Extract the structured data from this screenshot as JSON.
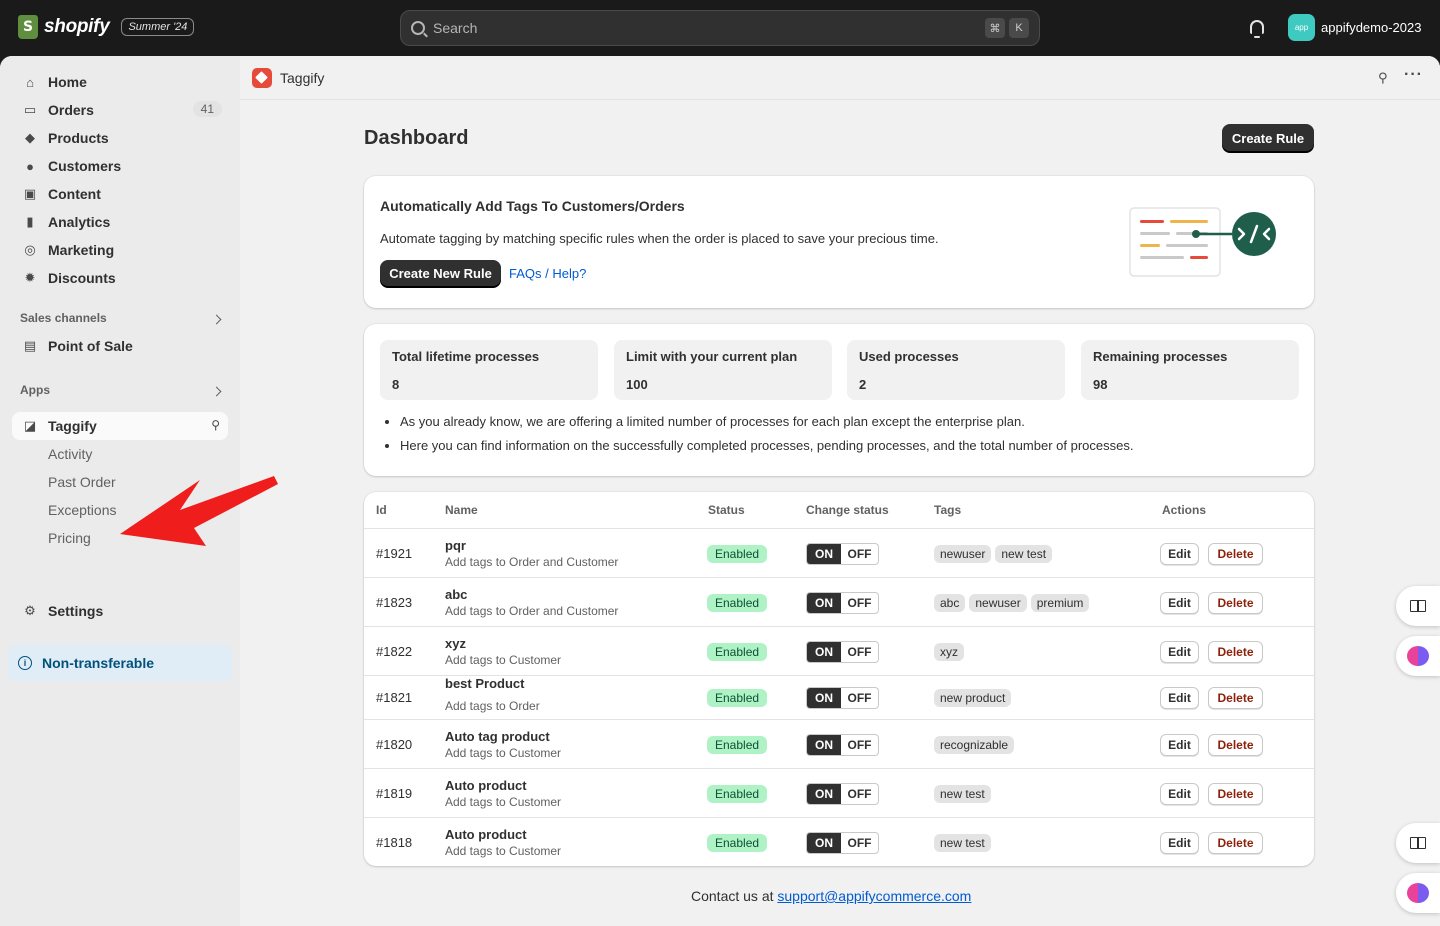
{
  "topbar": {
    "brand": "shopify",
    "edition": "Summer '24",
    "search_placeholder": "Search",
    "shortcut_keys": [
      "⌘",
      "K"
    ],
    "store_avatar": "app",
    "store_name": "appifydemo-2023"
  },
  "sidebar": {
    "items": [
      {
        "label": "Home",
        "icon": "home-icon"
      },
      {
        "label": "Orders",
        "icon": "orders-icon",
        "badge": "41"
      },
      {
        "label": "Products",
        "icon": "tag-icon"
      },
      {
        "label": "Customers",
        "icon": "person-icon"
      },
      {
        "label": "Content",
        "icon": "content-icon"
      },
      {
        "label": "Analytics",
        "icon": "bar-chart-icon"
      },
      {
        "label": "Marketing",
        "icon": "target-icon"
      },
      {
        "label": "Discounts",
        "icon": "discount-icon"
      }
    ],
    "sales_channels_label": "Sales channels",
    "point_of_sale": "Point of Sale",
    "apps_label": "Apps",
    "app_name": "Taggify",
    "app_subitems": [
      "Activity",
      "Past Order",
      "Exceptions",
      "Pricing"
    ],
    "settings": "Settings",
    "non_transferable": "Non-transferable"
  },
  "app_header": {
    "title": "Taggify"
  },
  "page": {
    "title": "Dashboard",
    "create_rule": "Create Rule"
  },
  "intro_card": {
    "title": "Automatically Add Tags To Customers/Orders",
    "description": "Automate tagging by matching specific rules when the order is placed to save your precious time.",
    "create_new_rule": "Create New Rule",
    "faq_link": "FAQs / Help?"
  },
  "stats": [
    {
      "label": "Total lifetime processes",
      "value": "8"
    },
    {
      "label": "Limit with your current plan",
      "value": "100"
    },
    {
      "label": "Used processes",
      "value": "2"
    },
    {
      "label": "Remaining processes",
      "value": "98"
    }
  ],
  "notes": [
    "As you already know, we are offering a limited number of processes for each plan except the enterprise plan.",
    "Here you can find information on the successfully completed processes, pending processes, and the total number of processes."
  ],
  "table": {
    "headers": [
      "Id",
      "Name",
      "Status",
      "Change status",
      "Tags",
      "Actions"
    ],
    "rows": [
      {
        "id": "#1921",
        "name": "pqr",
        "sub": "Add tags to Order and Customer",
        "status": "Enabled",
        "on": "ON",
        "off": "OFF",
        "tags": [
          "newuser",
          "new test"
        ],
        "edit": "Edit",
        "delete": "Delete"
      },
      {
        "id": "#1823",
        "name": "abc",
        "sub": "Add tags to Order and Customer",
        "status": "Enabled",
        "on": "ON",
        "off": "OFF",
        "tags": [
          "abc",
          "newuser",
          "premium"
        ],
        "edit": "Edit",
        "delete": "Delete"
      },
      {
        "id": "#1822",
        "name": "xyz",
        "sub": "Add tags to Customer",
        "status": "Enabled",
        "on": "ON",
        "off": "OFF",
        "tags": [
          "xyz"
        ],
        "edit": "Edit",
        "delete": "Delete"
      },
      {
        "id": "#1821",
        "name": "best Product",
        "sub": "Add tags to Order",
        "status": "Enabled",
        "on": "ON",
        "off": "OFF",
        "tags": [
          "new product"
        ],
        "edit": "Edit",
        "delete": "Delete"
      },
      {
        "id": "#1820",
        "name": "Auto tag product",
        "sub": "Add tags to Customer",
        "status": "Enabled",
        "on": "ON",
        "off": "OFF",
        "tags": [
          "recognizable"
        ],
        "edit": "Edit",
        "delete": "Delete"
      },
      {
        "id": "#1819",
        "name": "Auto product",
        "sub": "Add tags to Customer",
        "status": "Enabled",
        "on": "ON",
        "off": "OFF",
        "tags": [
          "new test"
        ],
        "edit": "Edit",
        "delete": "Delete"
      },
      {
        "id": "#1818",
        "name": "Auto product",
        "sub": "Add tags to Customer",
        "status": "Enabled",
        "on": "ON",
        "off": "OFF",
        "tags": [
          "new test"
        ],
        "edit": "Edit",
        "delete": "Delete"
      }
    ]
  },
  "contact": {
    "prefix": "Contact us at",
    "email": "support@appifycommerce.com"
  },
  "colors": {
    "accent_dark": "#303030",
    "enabled_badge": "#aff2c6",
    "delete_text": "#8e1f0b",
    "link": "#005bd3",
    "annotation_arrow": "#f01d1d"
  }
}
